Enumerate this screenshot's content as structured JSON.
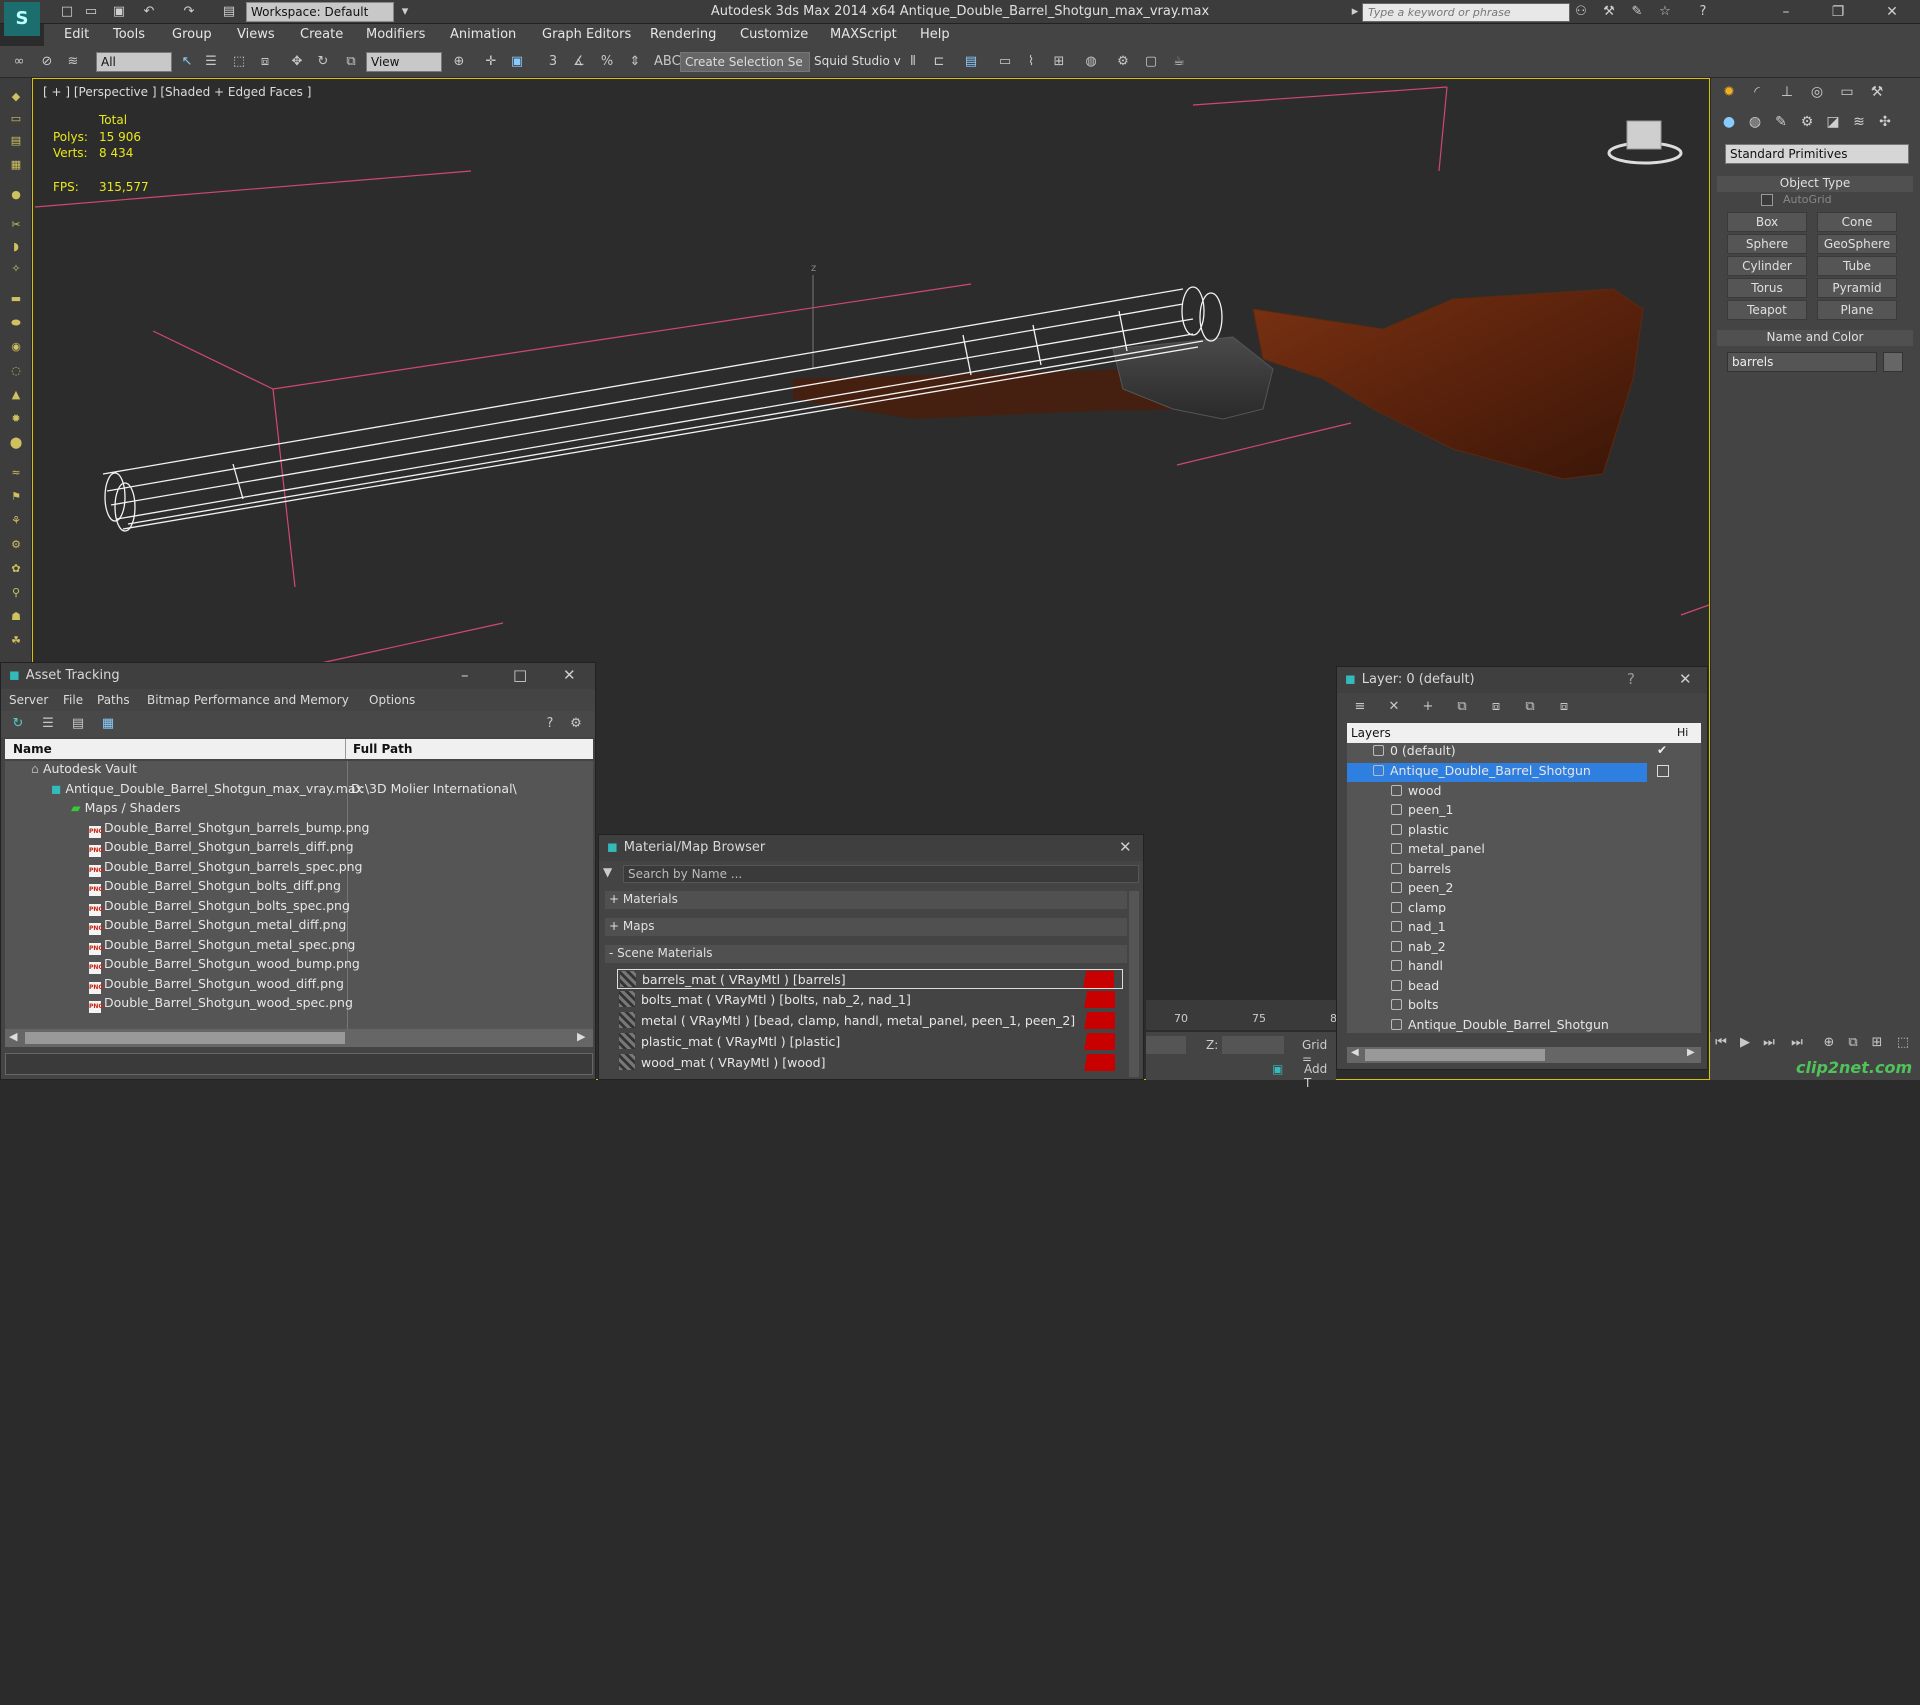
{
  "titlebar": {
    "app_title": "Autodesk 3ds Max  2014 x64     Antique_Double_Barrel_Shotgun_max_vray.max",
    "workspace": "Workspace: Default",
    "search_placeholder": "Type a keyword or phrase"
  },
  "menubar": [
    "Edit",
    "Tools",
    "Group",
    "Views",
    "Create",
    "Modifiers",
    "Animation",
    "Graph Editors",
    "Rendering",
    "Customize",
    "MAXScript",
    "Help"
  ],
  "toolbar": {
    "filter": "All",
    "coord_system": "View",
    "selection_set": "Create Selection Se",
    "studio": "Squid Studio v"
  },
  "viewport": {
    "label": "[ + ] [Perspective ] [Shaded + Edged Faces ]",
    "stats_header": "Total",
    "polys_label": "Polys:",
    "polys_value": "15 906",
    "verts_label": "Verts:",
    "verts_value": "8 434",
    "fps_label": "FPS:",
    "fps_value": "315,577",
    "axis_z": "z"
  },
  "cmdpanel": {
    "category": "Standard Primitives",
    "object_type_title": "Object Type",
    "autogrid": "AutoGrid",
    "buttons": [
      "Box",
      "Cone",
      "Sphere",
      "GeoSphere",
      "Cylinder",
      "Tube",
      "Torus",
      "Pyramid",
      "Teapot",
      "Plane"
    ],
    "name_color_title": "Name and Color",
    "name_value": "barrels"
  },
  "asset_tracking": {
    "title": "Asset Tracking",
    "menu": [
      "Server",
      "File",
      "Paths",
      "Bitmap Performance and Memory",
      "Options"
    ],
    "col_name": "Name",
    "col_path": "Full Path",
    "vault": "Autodesk Vault",
    "max_file": "Antique_Double_Barrel_Shotgun_max_vray.max",
    "max_path": "D:\\3D Molier International\\",
    "maps_folder": "Maps / Shaders",
    "files": [
      "Double_Barrel_Shotgun_barrels_bump.png",
      "Double_Barrel_Shotgun_barrels_diff.png",
      "Double_Barrel_Shotgun_barrels_spec.png",
      "Double_Barrel_Shotgun_bolts_diff.png",
      "Double_Barrel_Shotgun_bolts_spec.png",
      "Double_Barrel_Shotgun_metal_diff.png",
      "Double_Barrel_Shotgun_metal_spec.png",
      "Double_Barrel_Shotgun_wood_bump.png",
      "Double_Barrel_Shotgun_wood_diff.png",
      "Double_Barrel_Shotgun_wood_spec.png"
    ]
  },
  "material_browser": {
    "title": "Material/Map Browser",
    "search_placeholder": "Search by Name ...",
    "sec_materials": "+ Materials",
    "sec_maps": "+ Maps",
    "sec_scene": "- Scene Materials",
    "materials": [
      "barrels_mat  ( VRayMtl )  [barrels]",
      "bolts_mat  ( VRayMtl )  [bolts, nab_2, nad_1]",
      "metal  ( VRayMtl )  [bead, clamp, handl, metal_panel, peen_1, peen_2]",
      "plastic_mat  ( VRayMtl )  [plastic]",
      "wood_mat  ( VRayMtl )  [wood]"
    ]
  },
  "layers": {
    "title": "Layer: 0 (default)",
    "help": "?",
    "col_layers": "Layers",
    "col_hide": "Hi",
    "default_layer": "0 (default)",
    "active_layer": "Antique_Double_Barrel_Shotgun",
    "objects": [
      "wood",
      "peen_1",
      "plastic",
      "metal_panel",
      "barrels",
      "peen_2",
      "clamp",
      "nad_1",
      "nab_2",
      "handl",
      "bead",
      "bolts",
      "Antique_Double_Barrel_Shotgun"
    ]
  },
  "timeline": {
    "ticks": [
      "70",
      "75",
      "8"
    ],
    "z_label": "Z:",
    "grid_label": "Grid =",
    "add_label": "Add T"
  },
  "watermark": "clip2net.com"
}
